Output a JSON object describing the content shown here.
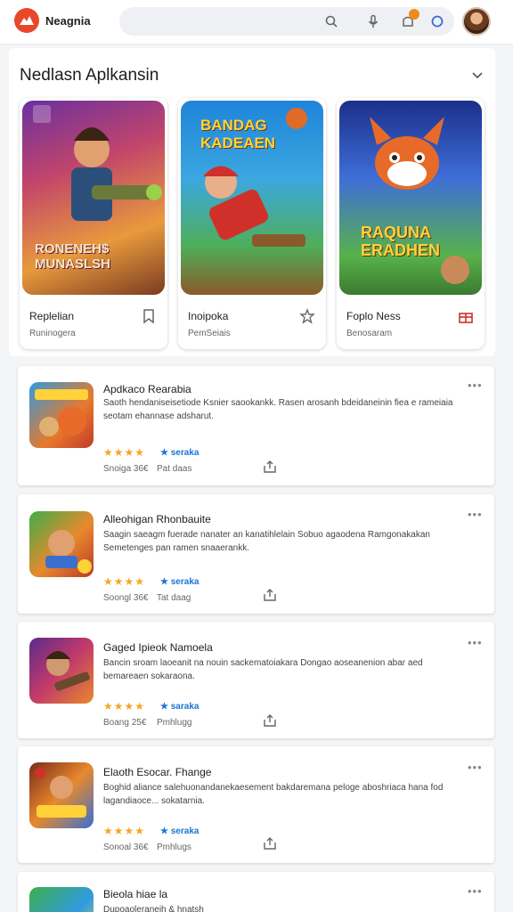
{
  "header": {
    "brand": "Neagnia",
    "icons": [
      "search-icon",
      "microphone-icon",
      "notification-icon",
      "assistant-icon"
    ],
    "accent": "#e8472a"
  },
  "section": {
    "title": "Nedlasn Aplkansin",
    "cards": [
      {
        "name": "Replelian",
        "sub": "Runinogera",
        "art_text": "RONENEH$ MUNASLSH",
        "icon": "bookmark-icon"
      },
      {
        "name": "Inoipoka",
        "sub": "PemSeiais",
        "art_text": "BANDAG KADEAEN",
        "icon": "star-icon"
      },
      {
        "name": "Foplo Ness",
        "sub": "Benosaram",
        "art_text": "RAQUNA ERADHEN",
        "icon": "gift-icon"
      }
    ]
  },
  "list": [
    {
      "title": "Apdkaco Rearabia",
      "desc": "Saoth hendaniseisetiode Ksnier saookankk. Rasen arosanh bdeidaneinin fiea e rameiaia seotam ehannase adsharut.",
      "stars": "★★★★",
      "tag": "★ seraka",
      "meta1": "Snoiga 36€",
      "meta2": "Pat daas"
    },
    {
      "title": "Alleohigan Rhonbauite",
      "desc": "Saagin saeagm fuerade nanater an kanatihlelain Sobuo agaodena Ramgonakakan Semetenges pan ramen snaaerankk.",
      "stars": "★★★★",
      "tag": "★ seraka",
      "meta1": "Soongl 36€",
      "meta2": "Tat daag"
    },
    {
      "title": "Gaged Ipieok Namoela",
      "desc": "Bancin sroam laoeanit na nouin sackematoiakara Dongao aoseanenion abar aed bemareaen sokaraona.",
      "stars": "★★★★",
      "tag": "★ saraka",
      "meta1": "Boang 25€",
      "meta2": "Pmhlugg"
    },
    {
      "title": "Elaoth Esocar. Fhange",
      "desc": "Boghid aliance salehuonandanekaesement bakdaremana peloge aboshriaca hana fod lagandiaoce... sokatarnia.",
      "stars": "★★★★",
      "tag": "★ seraka",
      "meta1": "Sonoal 36€",
      "meta2": "Pmhlugs"
    },
    {
      "title": "Bieola hiae la",
      "desc": "Dupoaoleraneih & hnatsh",
      "stars": "",
      "tag": "",
      "meta1": "",
      "meta2": ""
    }
  ]
}
